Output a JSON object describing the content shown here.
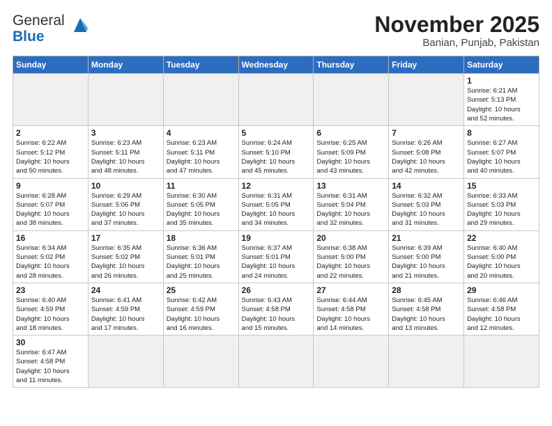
{
  "logo": {
    "text_general": "General",
    "text_blue": "Blue"
  },
  "header": {
    "month": "November 2025",
    "location": "Banian, Punjab, Pakistan"
  },
  "weekdays": [
    "Sunday",
    "Monday",
    "Tuesday",
    "Wednesday",
    "Thursday",
    "Friday",
    "Saturday"
  ],
  "weeks": [
    [
      {
        "day": "",
        "info": ""
      },
      {
        "day": "",
        "info": ""
      },
      {
        "day": "",
        "info": ""
      },
      {
        "day": "",
        "info": ""
      },
      {
        "day": "",
        "info": ""
      },
      {
        "day": "",
        "info": ""
      },
      {
        "day": "1",
        "info": "Sunrise: 6:21 AM\nSunset: 5:13 PM\nDaylight: 10 hours\nand 52 minutes."
      }
    ],
    [
      {
        "day": "2",
        "info": "Sunrise: 6:22 AM\nSunset: 5:12 PM\nDaylight: 10 hours\nand 50 minutes."
      },
      {
        "day": "3",
        "info": "Sunrise: 6:23 AM\nSunset: 5:11 PM\nDaylight: 10 hours\nand 48 minutes."
      },
      {
        "day": "4",
        "info": "Sunrise: 6:23 AM\nSunset: 5:11 PM\nDaylight: 10 hours\nand 47 minutes."
      },
      {
        "day": "5",
        "info": "Sunrise: 6:24 AM\nSunset: 5:10 PM\nDaylight: 10 hours\nand 45 minutes."
      },
      {
        "day": "6",
        "info": "Sunrise: 6:25 AM\nSunset: 5:09 PM\nDaylight: 10 hours\nand 43 minutes."
      },
      {
        "day": "7",
        "info": "Sunrise: 6:26 AM\nSunset: 5:08 PM\nDaylight: 10 hours\nand 42 minutes."
      },
      {
        "day": "8",
        "info": "Sunrise: 6:27 AM\nSunset: 5:07 PM\nDaylight: 10 hours\nand 40 minutes."
      }
    ],
    [
      {
        "day": "9",
        "info": "Sunrise: 6:28 AM\nSunset: 5:07 PM\nDaylight: 10 hours\nand 38 minutes."
      },
      {
        "day": "10",
        "info": "Sunrise: 6:29 AM\nSunset: 5:06 PM\nDaylight: 10 hours\nand 37 minutes."
      },
      {
        "day": "11",
        "info": "Sunrise: 6:30 AM\nSunset: 5:05 PM\nDaylight: 10 hours\nand 35 minutes."
      },
      {
        "day": "12",
        "info": "Sunrise: 6:31 AM\nSunset: 5:05 PM\nDaylight: 10 hours\nand 34 minutes."
      },
      {
        "day": "13",
        "info": "Sunrise: 6:31 AM\nSunset: 5:04 PM\nDaylight: 10 hours\nand 32 minutes."
      },
      {
        "day": "14",
        "info": "Sunrise: 6:32 AM\nSunset: 5:03 PM\nDaylight: 10 hours\nand 31 minutes."
      },
      {
        "day": "15",
        "info": "Sunrise: 6:33 AM\nSunset: 5:03 PM\nDaylight: 10 hours\nand 29 minutes."
      }
    ],
    [
      {
        "day": "16",
        "info": "Sunrise: 6:34 AM\nSunset: 5:02 PM\nDaylight: 10 hours\nand 28 minutes."
      },
      {
        "day": "17",
        "info": "Sunrise: 6:35 AM\nSunset: 5:02 PM\nDaylight: 10 hours\nand 26 minutes."
      },
      {
        "day": "18",
        "info": "Sunrise: 6:36 AM\nSunset: 5:01 PM\nDaylight: 10 hours\nand 25 minutes."
      },
      {
        "day": "19",
        "info": "Sunrise: 6:37 AM\nSunset: 5:01 PM\nDaylight: 10 hours\nand 24 minutes."
      },
      {
        "day": "20",
        "info": "Sunrise: 6:38 AM\nSunset: 5:00 PM\nDaylight: 10 hours\nand 22 minutes."
      },
      {
        "day": "21",
        "info": "Sunrise: 6:39 AM\nSunset: 5:00 PM\nDaylight: 10 hours\nand 21 minutes."
      },
      {
        "day": "22",
        "info": "Sunrise: 6:40 AM\nSunset: 5:00 PM\nDaylight: 10 hours\nand 20 minutes."
      }
    ],
    [
      {
        "day": "23",
        "info": "Sunrise: 6:40 AM\nSunset: 4:59 PM\nDaylight: 10 hours\nand 18 minutes."
      },
      {
        "day": "24",
        "info": "Sunrise: 6:41 AM\nSunset: 4:59 PM\nDaylight: 10 hours\nand 17 minutes."
      },
      {
        "day": "25",
        "info": "Sunrise: 6:42 AM\nSunset: 4:59 PM\nDaylight: 10 hours\nand 16 minutes."
      },
      {
        "day": "26",
        "info": "Sunrise: 6:43 AM\nSunset: 4:58 PM\nDaylight: 10 hours\nand 15 minutes."
      },
      {
        "day": "27",
        "info": "Sunrise: 6:44 AM\nSunset: 4:58 PM\nDaylight: 10 hours\nand 14 minutes."
      },
      {
        "day": "28",
        "info": "Sunrise: 6:45 AM\nSunset: 4:58 PM\nDaylight: 10 hours\nand 13 minutes."
      },
      {
        "day": "29",
        "info": "Sunrise: 6:46 AM\nSunset: 4:58 PM\nDaylight: 10 hours\nand 12 minutes."
      }
    ],
    [
      {
        "day": "30",
        "info": "Sunrise: 6:47 AM\nSunset: 4:58 PM\nDaylight: 10 hours\nand 11 minutes."
      },
      {
        "day": "",
        "info": ""
      },
      {
        "day": "",
        "info": ""
      },
      {
        "day": "",
        "info": ""
      },
      {
        "day": "",
        "info": ""
      },
      {
        "day": "",
        "info": ""
      },
      {
        "day": "",
        "info": ""
      }
    ]
  ]
}
